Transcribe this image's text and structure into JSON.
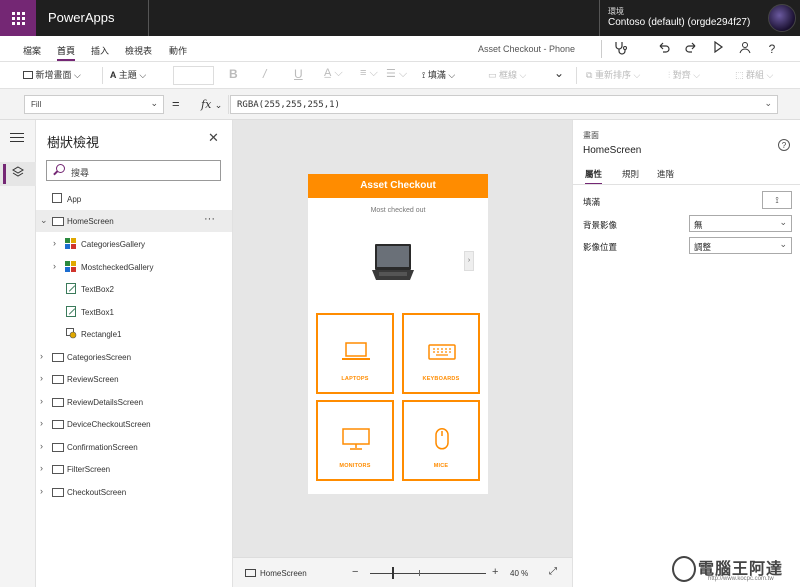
{
  "topbar": {
    "app_name": "PowerApps",
    "env_label": "環境",
    "env_name": "Contoso (default) (orgde294f27)"
  },
  "menubar": {
    "items": [
      "檔案",
      "首頁",
      "插入",
      "檢視表",
      "動作"
    ],
    "active": "首頁",
    "screen_title": "Asset Checkout - Phone"
  },
  "toolbar": {
    "new_screen": "新增畫面",
    "theme": "主題",
    "bold": "B",
    "italic": "/",
    "underline": "U",
    "fill": "填滿",
    "border": "框線",
    "reorder": "重新排序",
    "align": "對齊",
    "group": "群組"
  },
  "formula": {
    "property": "Fill",
    "equals": "=",
    "fx": "fx",
    "value": "RGBA(255,255,255,1)"
  },
  "tree": {
    "title": "樹狀檢視",
    "search_placeholder": "搜尋",
    "app_label": "App",
    "nodes": [
      {
        "label": "HomeScreen",
        "type": "screen",
        "selected": true
      },
      {
        "label": "CategoriesGallery",
        "type": "gallery"
      },
      {
        "label": "MostcheckedGallery",
        "type": "gallery"
      },
      {
        "label": "TextBox2",
        "type": "text"
      },
      {
        "label": "TextBox1",
        "type": "text"
      },
      {
        "label": "Rectangle1",
        "type": "rectangle"
      },
      {
        "label": "CategoriesScreen",
        "type": "screen"
      },
      {
        "label": "ReviewScreen",
        "type": "screen"
      },
      {
        "label": "ReviewDetailsScreen",
        "type": "screen"
      },
      {
        "label": "DeviceCheckoutScreen",
        "type": "screen"
      },
      {
        "label": "ConfirmationScreen",
        "type": "screen"
      },
      {
        "label": "FilterScreen",
        "type": "screen"
      },
      {
        "label": "CheckoutScreen",
        "type": "screen"
      }
    ],
    "more": "···"
  },
  "phone": {
    "header": "Asset Checkout",
    "most_checked": "Most checked out",
    "next": "›",
    "tiles": [
      "LAPTOPS",
      "KEYBOARDS",
      "MONITORS",
      "MICE"
    ],
    "accent": "#ff8c00"
  },
  "canvasbar": {
    "screen": "HomeScreen",
    "minus": "−",
    "plus": "+",
    "zoom": "40 %"
  },
  "props": {
    "kind": "畫面",
    "name": "HomeScreen",
    "help": "?",
    "tabs": [
      "屬性",
      "規則",
      "進階"
    ],
    "fill_label": "填滿",
    "bg_image_label": "背景影像",
    "bg_image_value": "無",
    "img_pos_label": "影像位置",
    "img_pos_value": "調整"
  },
  "watermark": {
    "text": "電腦王阿達",
    "url": "http://www.kocpc.com.tw"
  },
  "colors": {
    "brand": "#742774",
    "topbar": "#1f1f1f",
    "accent": "#ff8c00"
  }
}
